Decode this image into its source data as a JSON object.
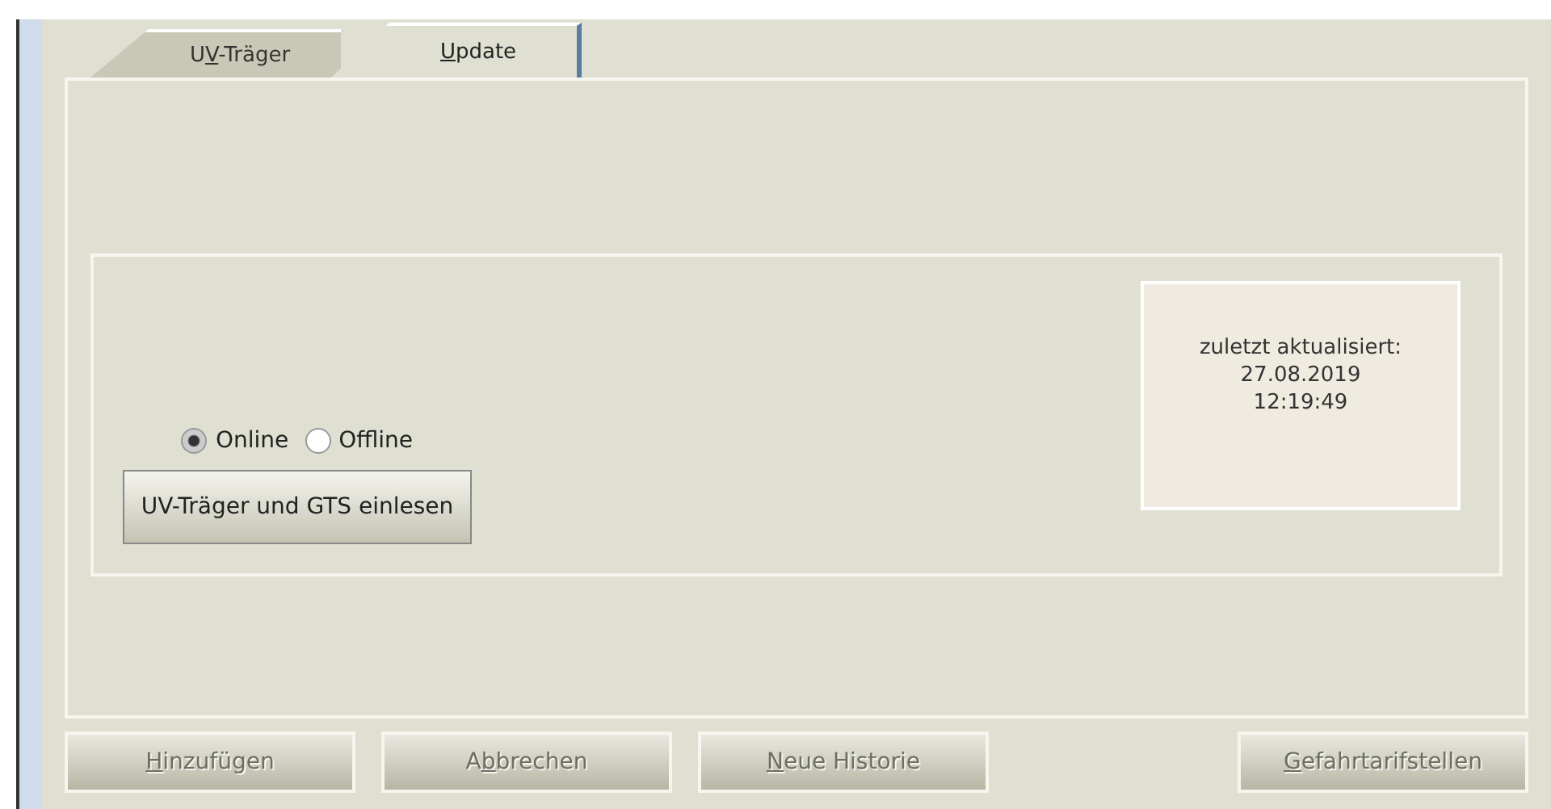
{
  "tabs": [
    {
      "label": [
        {
          "text": "U",
          "underlined": false
        },
        {
          "text": "V",
          "underlined": true
        },
        {
          "text": "-Träger",
          "underlined": false
        }
      ],
      "selected": false
    },
    {
      "label": [
        {
          "text": "U",
          "underlined": true
        },
        {
          "text": "pdate",
          "underlined": false
        }
      ],
      "selected": true
    }
  ],
  "mode": [
    {
      "label": "Online",
      "selected": true
    },
    {
      "label": "Offline",
      "selected": false
    }
  ],
  "import_button": {
    "label": "UV-Träger und GTS einlesen"
  },
  "last_update": [
    "zuletzt aktualisiert:",
    "27.08.2019",
    "12:19:49"
  ],
  "buttons": [
    {
      "label": [
        {
          "text": "H",
          "underlined": true
        },
        {
          "text": "inzufügen",
          "underlined": false
        }
      ],
      "disabled": true
    },
    {
      "label": [
        {
          "text": "A",
          "underlined": false
        },
        {
          "text": "b",
          "underlined": true
        },
        {
          "text": "brechen",
          "underlined": false
        }
      ],
      "disabled": true
    },
    {
      "label": [
        {
          "text": "N",
          "underlined": true
        },
        {
          "text": "eue Historie",
          "underlined": false
        }
      ],
      "disabled": true
    },
    {
      "label": [
        {
          "text": "G",
          "underlined": true
        },
        {
          "text": "efahrtarifstellen",
          "underlined": false
        }
      ],
      "disabled": true
    }
  ]
}
